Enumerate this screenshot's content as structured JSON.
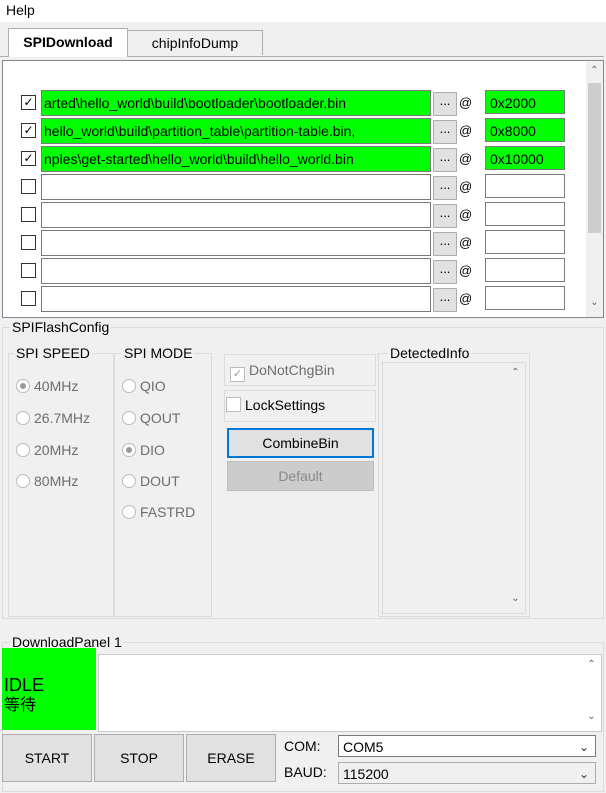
{
  "menu": {
    "help": "Help"
  },
  "tabs": [
    {
      "label": "SPIDownload"
    },
    {
      "label": "chipInfoDump"
    }
  ],
  "files": [
    {
      "checked": true,
      "path": "arted\\hello_world\\build\\bootloader\\bootloader.bin",
      "browse": "...",
      "at": "@",
      "address": "0x2000"
    },
    {
      "checked": true,
      "path": ",hello_world\\build\\partition_table\\partition-table.bin",
      "browse": "...",
      "at": "@",
      "address": "0x8000"
    },
    {
      "checked": true,
      "path": "nples\\get-started\\hello_world\\build\\hello_world.bin",
      "browse": "...",
      "at": "@",
      "address": "0x10000"
    },
    {
      "checked": false,
      "path": "",
      "browse": "...",
      "at": "@",
      "address": ""
    },
    {
      "checked": false,
      "path": "",
      "browse": "...",
      "at": "@",
      "address": ""
    },
    {
      "checked": false,
      "path": "",
      "browse": "...",
      "at": "@",
      "address": ""
    },
    {
      "checked": false,
      "path": "",
      "browse": "...",
      "at": "@",
      "address": ""
    },
    {
      "checked": false,
      "path": "",
      "browse": "...",
      "at": "@",
      "address": ""
    }
  ],
  "spiflash": {
    "title": "SPIFlashConfig",
    "speed_title": "SPI SPEED",
    "speed_options": [
      "40MHz",
      "26.7MHz",
      "20MHz",
      "80MHz"
    ],
    "mode_title": "SPI MODE",
    "mode_options": [
      "QIO",
      "QOUT",
      "DIO",
      "DOUT",
      "FASTRD"
    ],
    "do_not_chg_bin": "DoNotChgBin",
    "lock_settings": "LockSettings",
    "combine_bin": "CombineBin",
    "default": "Default",
    "detected_title": "DetectedInfo"
  },
  "download": {
    "title": "DownloadPanel 1",
    "status_en": "IDLE",
    "status_cn": "等待",
    "start": "START",
    "stop": "STOP",
    "erase": "ERASE",
    "com_label": "COM:",
    "com_value": "COM5",
    "baud_label": "BAUD:",
    "baud_value": "115200"
  },
  "colors": {
    "active_green": "#00ff00",
    "accent": "#0078d7"
  }
}
